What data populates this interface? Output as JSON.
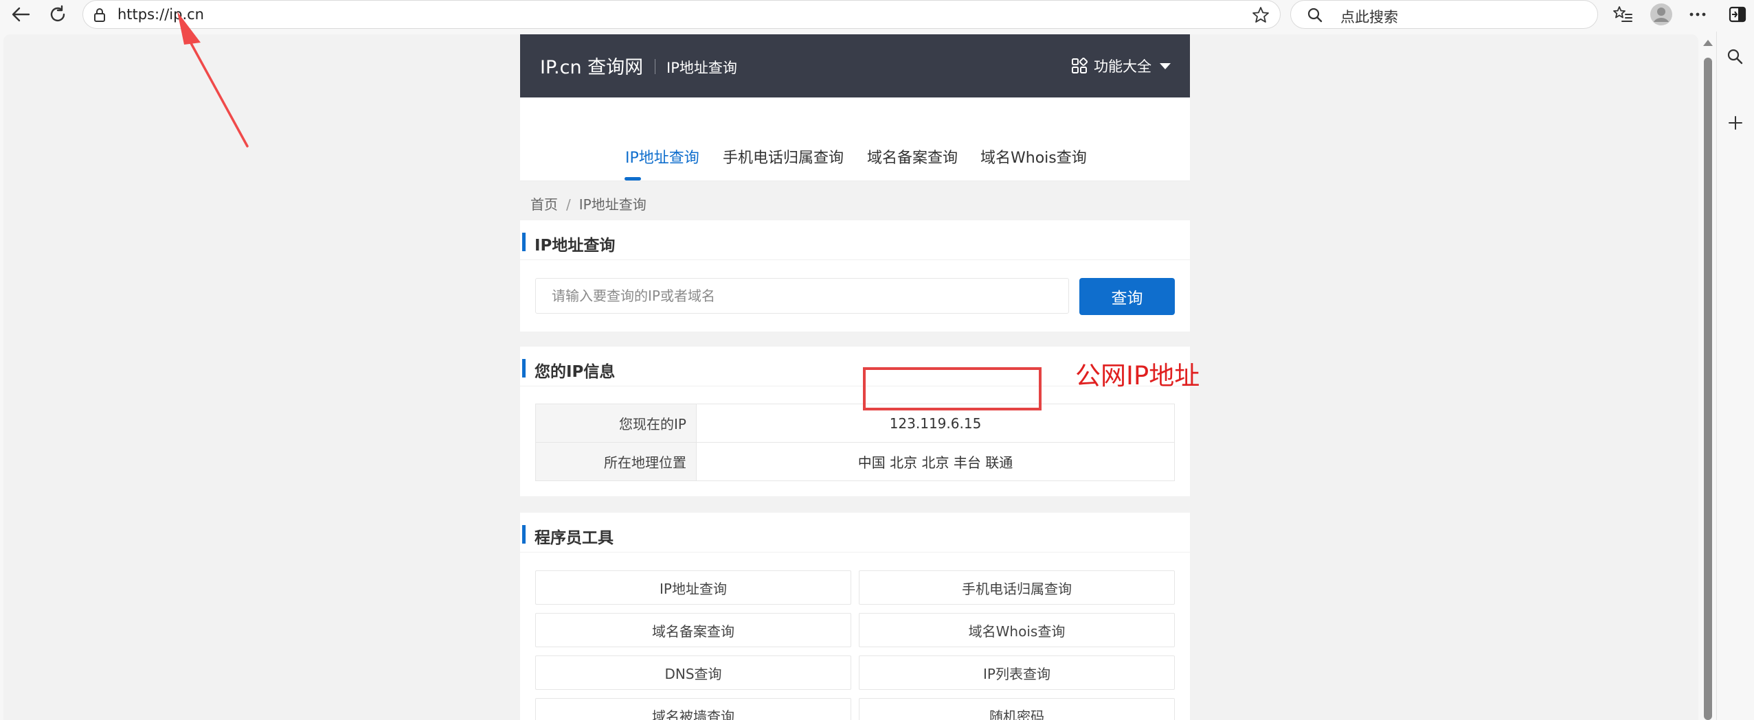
{
  "browser": {
    "url": "https://ip.cn",
    "search_placeholder": "点此搜索"
  },
  "site": {
    "logo": "IP.cn 查询网",
    "subtitle": "IP地址查询",
    "features_menu": "功能大全",
    "nav": [
      {
        "label": "IP地址查询",
        "active": true
      },
      {
        "label": "手机电话归属查询",
        "active": false
      },
      {
        "label": "域名备案查询",
        "active": false
      },
      {
        "label": "域名Whois查询",
        "active": false
      }
    ],
    "breadcrumb": {
      "home": "首页",
      "sep": "/",
      "current": "IP地址查询"
    }
  },
  "query_panel": {
    "title": "IP地址查询",
    "input_placeholder": "请输入要查询的IP或者域名",
    "button": "查询"
  },
  "ip_panel": {
    "title": "您的IP信息",
    "rows": [
      {
        "key": "您现在的IP",
        "value": "123.119.6.15"
      },
      {
        "key": "所在地理位置",
        "value": "中国 北京 北京 丰台 联通"
      }
    ]
  },
  "tools_panel": {
    "title": "程序员工具",
    "tools": [
      "IP地址查询",
      "手机电话归属查询",
      "域名备案查询",
      "域名Whois查询",
      "DNS查询",
      "IP列表查询",
      "域名被墙查询",
      "随机密码"
    ]
  },
  "annotation": {
    "label": "公网IP地址",
    "color": "#e02020"
  },
  "colors": {
    "header_bg": "#393d49",
    "accent": "#0f6ecd"
  }
}
